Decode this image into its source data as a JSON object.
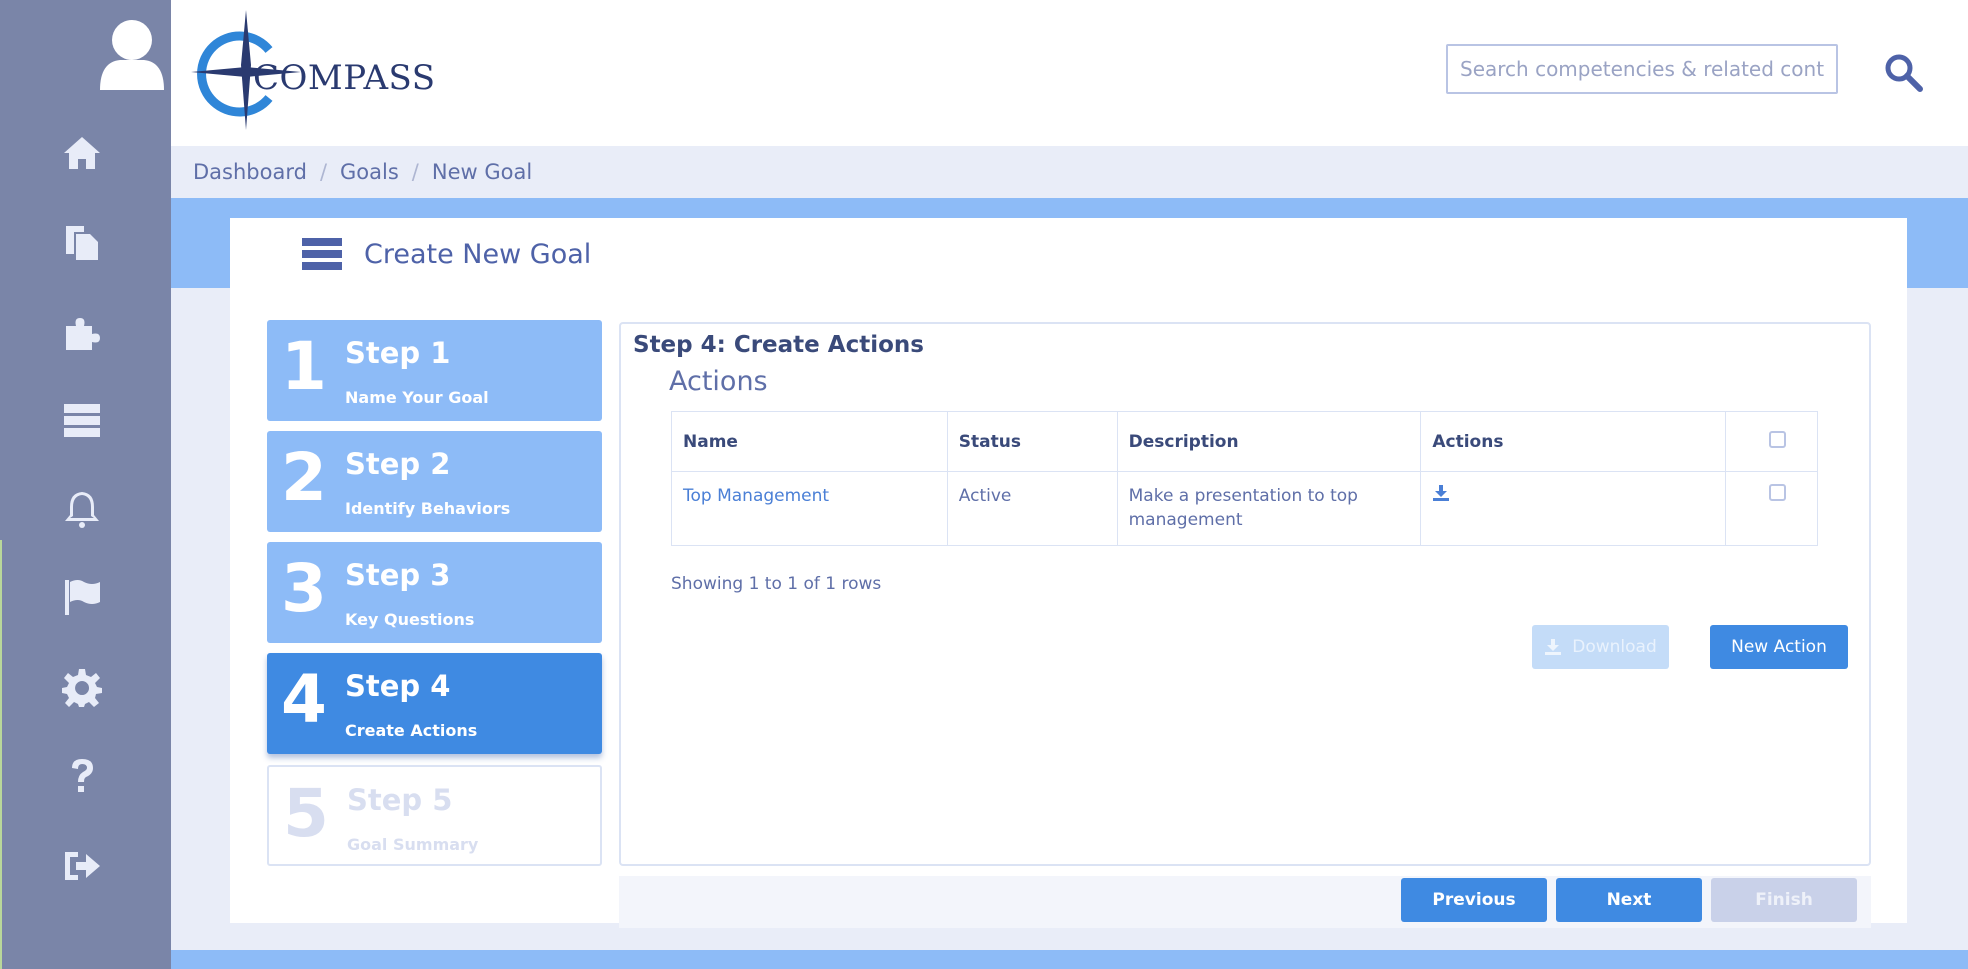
{
  "header": {
    "logo_text": "COMPASS",
    "search": {
      "placeholder": "Search competencies & related content",
      "value": ""
    }
  },
  "sidebar": {
    "icons": [
      "user-icon",
      "home-icon",
      "documents-icon",
      "puzzle-icon",
      "server-icon",
      "bell-icon",
      "flag-icon",
      "gear-icon",
      "question-icon",
      "sign-out-icon"
    ]
  },
  "breadcrumb": {
    "items": [
      "Dashboard",
      "Goals",
      "New Goal"
    ],
    "separator": "/"
  },
  "panel": {
    "title": "Create New Goal"
  },
  "steps": [
    {
      "num": "1",
      "title": "Step 1",
      "sub": "Name Your Goal",
      "state": "done"
    },
    {
      "num": "2",
      "title": "Step 2",
      "sub": "Identify Behaviors",
      "state": "done"
    },
    {
      "num": "3",
      "title": "Step 3",
      "sub": "Key Questions",
      "state": "done"
    },
    {
      "num": "4",
      "title": "Step 4",
      "sub": "Create Actions",
      "state": "active"
    },
    {
      "num": "5",
      "title": "Step 5",
      "sub": "Goal Summary",
      "state": "disabled"
    }
  ],
  "content": {
    "heading": "Step 4: Create Actions",
    "subheading": "Actions",
    "table": {
      "columns": [
        "Name",
        "Status",
        "Description",
        "Actions"
      ],
      "rows": [
        {
          "name": "Top Management",
          "status": "Active",
          "description": "Make a presentation to top management"
        }
      ]
    },
    "rows_info": "Showing 1 to 1 of 1 rows",
    "download_label": "Download",
    "new_action_label": "New Action"
  },
  "footer": {
    "previous_label": "Previous",
    "next_label": "Next",
    "finish_label": "Finish"
  },
  "colors": {
    "sidebar": "#7a85a8",
    "accent": "#3f8ae2",
    "step_inactive": "#8dbbf7",
    "band": "#8dbbf7"
  }
}
